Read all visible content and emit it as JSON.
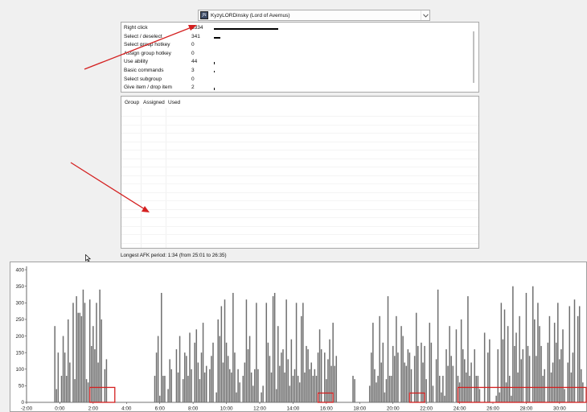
{
  "player": {
    "icon_text": "JN",
    "name": "KyzyLORDinsky (Lord of Avernus)"
  },
  "stats": [
    {
      "label": "Right click",
      "value": "3334",
      "count": 3334
    },
    {
      "label": "Select / deselect",
      "value": "341",
      "count": 341
    },
    {
      "label": "Select group hotkey",
      "value": "0",
      "count": 0
    },
    {
      "label": "Assign group hotkey",
      "value": "0",
      "count": 0
    },
    {
      "label": "Use ability",
      "value": "44",
      "count": 44
    },
    {
      "label": "Basic commands",
      "value": "3",
      "count": 3
    },
    {
      "label": "Select subgroup",
      "value": "0",
      "count": 0
    },
    {
      "label": "Give item / drop item",
      "value": "2",
      "count": 2
    }
  ],
  "groups_table": {
    "columns": [
      "Group",
      "Assigned",
      "Used"
    ]
  },
  "afk_text": "Longest AFK period: 1:34 (from 25:01 to 26:35)",
  "colors": {
    "bar": "#6e6e6e",
    "annotation": "#d42020"
  },
  "chart_data": {
    "type": "bar",
    "title": "",
    "xlabel": "",
    "ylabel": "",
    "xlim_minutes": [
      -2,
      31.6
    ],
    "ylim": [
      0,
      410
    ],
    "yticks": [
      "400",
      "350",
      "300",
      "250",
      "200",
      "150",
      "100",
      "50",
      "0"
    ],
    "ytick_values": [
      400,
      350,
      300,
      250,
      200,
      150,
      100,
      50,
      0
    ],
    "xticks": [
      "-2:00",
      "0:00",
      "2:00",
      "4:00",
      "6:00",
      "8:00",
      "10:00",
      "12:00",
      "14:00",
      "16:00",
      "18:00",
      "20:00",
      "22:00",
      "24:00",
      "26:00",
      "28:00",
      "30:00"
    ],
    "xtick_minutes": [
      -2,
      0,
      2,
      4,
      6,
      8,
      10,
      12,
      14,
      16,
      18,
      20,
      22,
      24,
      26,
      28,
      30
    ],
    "series": [
      {
        "x_start_minutes": -0.7,
        "x_step_minutes": 0.1,
        "values": [
          0,
          0,
          0,
          0,
          230,
          40,
          150,
          0,
          80,
          200,
          150,
          80,
          250,
          120,
          0,
          300,
          70,
          320,
          270,
          270,
          260,
          340,
          300,
          70,
          60,
          310,
          170,
          230,
          160,
          300,
          120,
          340,
          250,
          0,
          100,
          130,
          0,
          0,
          0,
          0,
          0,
          0,
          0,
          0,
          0,
          0,
          0,
          0,
          0,
          0,
          0,
          0,
          0,
          0,
          0,
          0,
          0,
          0,
          0,
          0,
          0,
          0,
          0,
          0,
          80,
          150,
          200,
          20,
          330,
          80,
          80,
          0,
          40,
          130,
          100,
          0,
          0,
          160,
          90,
          200,
          0,
          70,
          150,
          140,
          80,
          210,
          100,
          0,
          180,
          220,
          120,
          70,
          150,
          240,
          90,
          110,
          0,
          100,
          140,
          180,
          0,
          30,
          250,
          200,
          290,
          120,
          310,
          180,
          140,
          100,
          90,
          330,
          150,
          30,
          100,
          60,
          0,
          80,
          120,
          310,
          160,
          200,
          90,
          50,
          100,
          300,
          100,
          0,
          30,
          50,
          0,
          300,
          180,
          140,
          90,
          320,
          330,
          40,
          230,
          110,
          150,
          160,
          90,
          310,
          130,
          50,
          190,
          80,
          100,
          300,
          80,
          60,
          260,
          300,
          90,
          170,
          160,
          100,
          120,
          80,
          100,
          80,
          150,
          220,
          160,
          0,
          150,
          70,
          130,
          190,
          110,
          240,
          110,
          140,
          0,
          0,
          0,
          0,
          0,
          0,
          0,
          0,
          0,
          80,
          70,
          0,
          0,
          0,
          0,
          0,
          0,
          0,
          0,
          50,
          150,
          240,
          100,
          60,
          80,
          260,
          120,
          180,
          30,
          70,
          320,
          80,
          80,
          170,
          140,
          260,
          150,
          0,
          230,
          200,
          120,
          110,
          160,
          150,
          100,
          0,
          140,
          270,
          170,
          0,
          180,
          120,
          170,
          70,
          0,
          240,
          180,
          50,
          0,
          130,
          340,
          80,
          30,
          80,
          20,
          160,
          110,
          230,
          140,
          110,
          0,
          220,
          80,
          60,
          250,
          160,
          130,
          90,
          320,
          80,
          120,
          0,
          160,
          80,
          80,
          40,
          0,
          0,
          210,
          0,
          150,
          190,
          0,
          0,
          0,
          20,
          160,
          30,
          300,
          190,
          280,
          60,
          230,
          80,
          20,
          350,
          170,
          210,
          90,
          260,
          130,
          160,
          0,
          330,
          170,
          140,
          0,
          350,
          250,
          140,
          300,
          230,
          170,
          80,
          100,
          0,
          180,
          260,
          90,
          120,
          240,
          180,
          300,
          130,
          160,
          220,
          40,
          0,
          120,
          290,
          90,
          150,
          310,
          0,
          260,
          290,
          100,
          60,
          0,
          190,
          70,
          50,
          80,
          180,
          0,
          350,
          320,
          330,
          280,
          0,
          350,
          300,
          130,
          40,
          0,
          0,
          0,
          0,
          0,
          0,
          0,
          0,
          0,
          0,
          5,
          10,
          0,
          0,
          20,
          0,
          0,
          0,
          0,
          40,
          0,
          0,
          0,
          0,
          0,
          0,
          0,
          0,
          30,
          0,
          0,
          0,
          0,
          0,
          0,
          60,
          0,
          0,
          0,
          0,
          0,
          0,
          0,
          0,
          0,
          90,
          0,
          0,
          0,
          40,
          0,
          0,
          0,
          0,
          0,
          80,
          0,
          0,
          0,
          0,
          0,
          0,
          0,
          0,
          0,
          50,
          0,
          30,
          0,
          0,
          0,
          0,
          0,
          0,
          0,
          0,
          0,
          70,
          0,
          0,
          0,
          0,
          0,
          60,
          0,
          0,
          0,
          0,
          0,
          0,
          0,
          0,
          0,
          0,
          0,
          30,
          0,
          0,
          0,
          60,
          0,
          0,
          0,
          0,
          0,
          0,
          0,
          0,
          0,
          0,
          0,
          0,
          0,
          40,
          0,
          0,
          0,
          0,
          0,
          0,
          0,
          0,
          0,
          0,
          0,
          0,
          0,
          90,
          0,
          0,
          0,
          0,
          0,
          0,
          0,
          0,
          0,
          0,
          80,
          0,
          0,
          0,
          60,
          0,
          230
        ]
      }
    ]
  }
}
